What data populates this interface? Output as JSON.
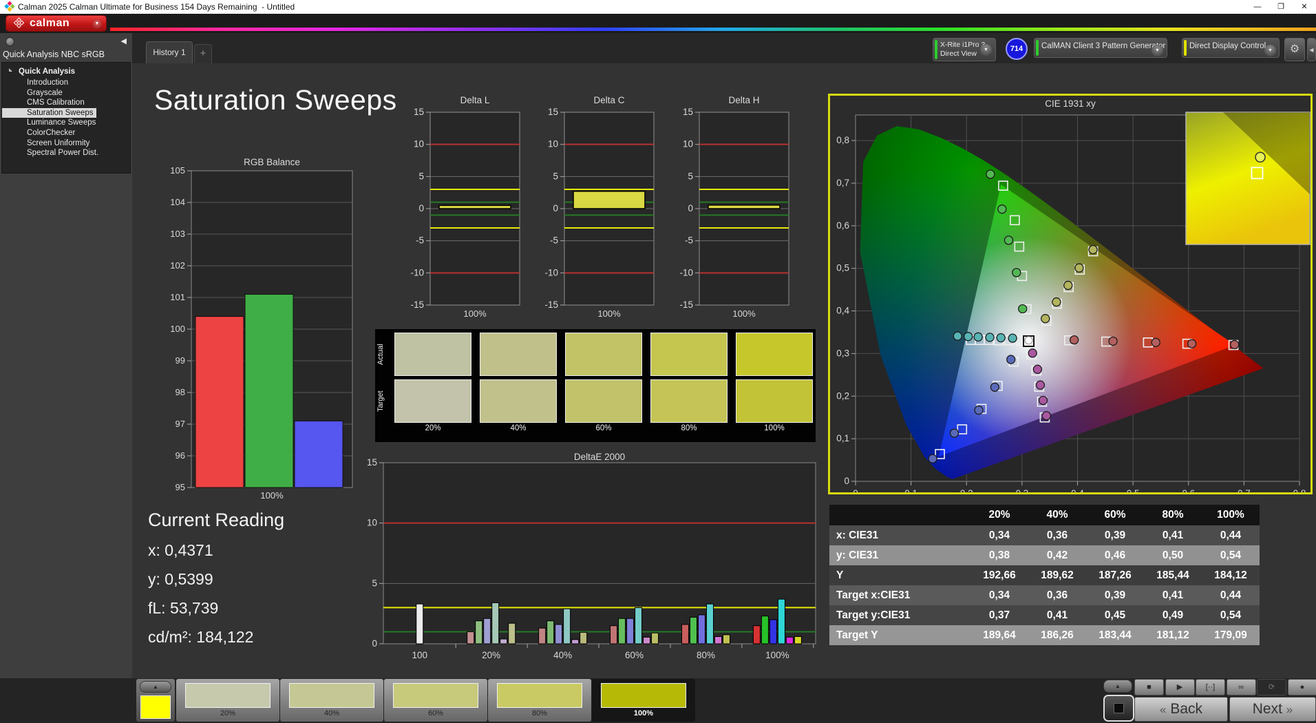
{
  "window": {
    "title": "Calman 2025 Calman Ultimate for Business 154 Days Remaining  - Untitled",
    "minimize": "—",
    "restore": "❐",
    "close": "✕"
  },
  "brand": {
    "logo_text": "calman"
  },
  "tabs": {
    "active": "History 1",
    "add": "+"
  },
  "devices": {
    "meter_line1": "X-Rite i1Pro 3",
    "meter_line2": "Direct View",
    "meter_badge": "714",
    "meter_stripe_color": "#2ecc2e",
    "pattern_generator": "CalMAN Client 3 Pattern Generator",
    "pattern_stripe_color": "#2ecc2e",
    "display_control": "Direct Display Control",
    "display_stripe_color": "#e0e000",
    "gear": "⚙",
    "collapse_arrow": "◀"
  },
  "sidebar": {
    "title": "Quick Analysis NBC sRGB",
    "root": "Quick Analysis",
    "items": [
      {
        "label": "Introduction",
        "selected": false
      },
      {
        "label": "Grayscale",
        "selected": false
      },
      {
        "label": "CMS Calibration",
        "selected": false
      },
      {
        "label": "Saturation Sweeps",
        "selected": true
      },
      {
        "label": "Luminance Sweeps",
        "selected": false
      },
      {
        "label": "ColorChecker",
        "selected": false
      },
      {
        "label": "Screen Uniformity",
        "selected": false
      },
      {
        "label": "Spectral Power Dist.",
        "selected": false
      }
    ]
  },
  "page": {
    "title": "Saturation Sweeps"
  },
  "current_reading": {
    "title": "Current Reading",
    "x": "x: 0,4371",
    "y": "y: 0,5399",
    "fl": "fL: 53,739",
    "cdm2": "cd/m²: 184,122"
  },
  "swatch_panel": {
    "row_labels": [
      "Actual",
      "Target"
    ],
    "labels": [
      "20%",
      "40%",
      "60%",
      "80%",
      "100%"
    ],
    "actual": [
      "#bfc2a3",
      "#bfc08a",
      "#c2c366",
      "#c5c650",
      "#c6c72a"
    ],
    "target": [
      "#c2c3aa",
      "#c0c18b",
      "#c1c269",
      "#c4c556",
      "#c2c336"
    ]
  },
  "table": {
    "headers": [
      "",
      "20%",
      "40%",
      "60%",
      "80%",
      "100%"
    ],
    "rows": [
      {
        "label": "x: CIE31",
        "values": [
          "0,34",
          "0,36",
          "0,39",
          "0,41",
          "0,44"
        ],
        "bg": "#4c4c4c"
      },
      {
        "label": "y: CIE31",
        "values": [
          "0,38",
          "0,42",
          "0,46",
          "0,50",
          "0,54"
        ],
        "bg": "#919191"
      },
      {
        "label": "Y",
        "values": [
          "192,66",
          "189,62",
          "187,26",
          "185,44",
          "184,12"
        ],
        "bg": "#3c3c3c"
      },
      {
        "label": "Target x:CIE31",
        "values": [
          "0,34",
          "0,36",
          "0,39",
          "0,41",
          "0,44"
        ],
        "bg": "#5a5a5a"
      },
      {
        "label": "Target y:CIE31",
        "values": [
          "0,37",
          "0,41",
          "0,45",
          "0,49",
          "0,54"
        ],
        "bg": "#454545"
      },
      {
        "label": "Target Y",
        "values": [
          "189,64",
          "186,26",
          "183,44",
          "181,12",
          "179,09"
        ],
        "bg": "#969696"
      }
    ]
  },
  "bottom_bar": {
    "mini_swatch_color": "#ffff00",
    "swatches": [
      {
        "label": "20%",
        "color": "#c6c9ac",
        "selected": false
      },
      {
        "label": "40%",
        "color": "#c5c794",
        "selected": false
      },
      {
        "label": "60%",
        "color": "#c7c97b",
        "selected": false
      },
      {
        "label": "80%",
        "color": "#caca64",
        "selected": false
      },
      {
        "label": "100%",
        "color": "#b6ba06",
        "selected": true
      }
    ],
    "icons": [
      "■",
      "▶",
      "[··]",
      "∞",
      "⟳",
      "●"
    ],
    "back": "Back",
    "next": "Next",
    "back_chev": "«",
    "next_chev": "»",
    "up_arrow": "▲"
  },
  "chart_data": [
    {
      "id": "rgb_balance",
      "type": "bar",
      "title": "RGB Balance",
      "categories": [
        "Red",
        "Green",
        "Blue"
      ],
      "values": [
        100.4,
        101.1,
        97.1
      ],
      "colors": [
        "#ee4343",
        "#3fae46",
        "#5656f0"
      ],
      "xlabel": "100%",
      "ylim": [
        95,
        105
      ],
      "ytick_step": 1,
      "grid": true
    },
    {
      "id": "delta_l",
      "type": "delta-bar",
      "title": "Delta L",
      "value": 0.5,
      "bar_color": "#d9d943",
      "xlabel": "100%",
      "ylim": [
        -15,
        15
      ],
      "yticks": [
        15,
        10,
        5,
        0,
        -5,
        -10,
        -15
      ],
      "ref_lines": [
        {
          "y": 10,
          "color": "#b93030"
        },
        {
          "y": -10,
          "color": "#b93030"
        },
        {
          "y": 3,
          "color": "#e8e80a"
        },
        {
          "y": -3,
          "color": "#e8e80a"
        },
        {
          "y": 1,
          "color": "#267a26"
        },
        {
          "y": -1,
          "color": "#267a26"
        }
      ]
    },
    {
      "id": "delta_c",
      "type": "delta-bar",
      "title": "Delta C",
      "value": 2.7,
      "bar_color": "#d9d943",
      "xlabel": "100%",
      "ylim": [
        -15,
        15
      ],
      "yticks": [
        15,
        10,
        5,
        0,
        -5,
        -10,
        -15
      ],
      "ref_lines": [
        {
          "y": 10,
          "color": "#b93030"
        },
        {
          "y": -10,
          "color": "#b93030"
        },
        {
          "y": 3,
          "color": "#e8e80a"
        },
        {
          "y": -3,
          "color": "#e8e80a"
        },
        {
          "y": 1,
          "color": "#267a26"
        },
        {
          "y": -1,
          "color": "#267a26"
        }
      ]
    },
    {
      "id": "delta_h",
      "type": "delta-bar",
      "title": "Delta H",
      "value": 0.55,
      "bar_color": "#d9d943",
      "xlabel": "100%",
      "ylim": [
        -15,
        15
      ],
      "yticks": [
        15,
        10,
        5,
        0,
        -5,
        -10,
        -15
      ],
      "ref_lines": [
        {
          "y": 10,
          "color": "#b93030"
        },
        {
          "y": -10,
          "color": "#b93030"
        },
        {
          "y": 3,
          "color": "#e8e80a"
        },
        {
          "y": -3,
          "color": "#e8e80a"
        },
        {
          "y": 1,
          "color": "#267a26"
        },
        {
          "y": -1,
          "color": "#267a26"
        }
      ]
    },
    {
      "id": "deltae_2000",
      "type": "grouped-bar",
      "title": "DeltaE 2000",
      "ylim": [
        0,
        15
      ],
      "yticks": [
        0,
        5,
        10,
        15
      ],
      "ref_lines": [
        {
          "y": 10,
          "color": "#b93030"
        },
        {
          "y": 3,
          "color": "#e8e80a"
        },
        {
          "y": 1,
          "color": "#267a26"
        }
      ],
      "groups": [
        {
          "label": "100",
          "values": [
            3.3
          ],
          "colors": [
            "#ececec"
          ]
        },
        {
          "label": "20%",
          "values": [
            1.0,
            1.9,
            2.1,
            3.4,
            0.4,
            1.7
          ],
          "colors": [
            "#c18f8f",
            "#8fbf80",
            "#9f9fd2",
            "#a6c8b6",
            "#c0aed0",
            "#bcbf8a"
          ]
        },
        {
          "label": "40%",
          "values": [
            1.3,
            1.9,
            1.6,
            2.9,
            0.35,
            0.95
          ],
          "colors": [
            "#c08484",
            "#7eba72",
            "#8f8fd2",
            "#8ec8c2",
            "#c49fd0",
            "#b8ba7c"
          ]
        },
        {
          "label": "60%",
          "values": [
            1.5,
            2.1,
            2.1,
            3.0,
            0.55,
            0.9
          ],
          "colors": [
            "#c27474",
            "#67bc5e",
            "#8080d8",
            "#73ccc8",
            "#cc8bcc",
            "#babd66"
          ]
        },
        {
          "label": "80%",
          "values": [
            1.6,
            2.2,
            2.4,
            3.3,
            0.6,
            0.75
          ],
          "colors": [
            "#c85e5e",
            "#4fc04f",
            "#6f6fde",
            "#5bd0d0",
            "#d476d4",
            "#c0c252"
          ]
        },
        {
          "label": "100%",
          "values": [
            1.5,
            2.3,
            2.0,
            3.7,
            0.55,
            0.6
          ],
          "colors": [
            "#d63232",
            "#28c228",
            "#3333e6",
            "#2fd6d6",
            "#dc2adc",
            "#d6d626"
          ]
        }
      ]
    },
    {
      "id": "cie_1931",
      "type": "scatter",
      "title": "CIE 1931 xy",
      "xlim": [
        0,
        0.8
      ],
      "ylim": [
        0,
        0.86
      ],
      "xticks": [
        "0",
        "0,1",
        "0,2",
        "0,3",
        "0,4",
        "0,5",
        "0,6",
        "0,7",
        "0,8"
      ],
      "yticks": [
        "0",
        "0,1",
        "0,2",
        "0,3",
        "0,4",
        "0,5",
        "0,6",
        "0,7",
        "0,8"
      ],
      "gamut_triangle": [
        [
          0.684,
          0.32
        ],
        [
          0.262,
          0.697
        ],
        [
          0.15,
          0.058
        ]
      ],
      "white_point": {
        "square": [
          0.312,
          0.329
        ],
        "circle": [
          0.312,
          0.331
        ]
      },
      "series": [
        {
          "name": "red-sweep",
          "color": "#b46060",
          "squares": [
            [
              0.385,
              0.331
            ],
            [
              0.452,
              0.328
            ],
            [
              0.527,
              0.326
            ],
            [
              0.598,
              0.323
            ],
            [
              0.681,
              0.32
            ]
          ],
          "circles": [
            [
              0.394,
              0.332
            ],
            [
              0.464,
              0.329
            ],
            [
              0.541,
              0.326
            ],
            [
              0.606,
              0.323
            ],
            [
              0.683,
              0.321
            ]
          ]
        },
        {
          "name": "green-sweep",
          "color": "#52b852",
          "squares": [
            [
              0.308,
              0.404
            ],
            [
              0.3,
              0.482
            ],
            [
              0.295,
              0.551
            ],
            [
              0.287,
              0.613
            ],
            [
              0.266,
              0.694
            ]
          ],
          "circles": [
            [
              0.301,
              0.405
            ],
            [
              0.29,
              0.49
            ],
            [
              0.276,
              0.566
            ],
            [
              0.264,
              0.639
            ],
            [
              0.243,
              0.721
            ]
          ]
        },
        {
          "name": "yellow-sweep",
          "color": "#b2b45e",
          "squares": [
            [
              0.344,
              0.377
            ],
            [
              0.363,
              0.417
            ],
            [
              0.384,
              0.456
            ],
            [
              0.404,
              0.497
            ],
            [
              0.428,
              0.54
            ]
          ],
          "circles": [
            [
              0.342,
              0.382
            ],
            [
              0.362,
              0.421
            ],
            [
              0.383,
              0.46
            ],
            [
              0.403,
              0.501
            ],
            [
              0.428,
              0.544
            ]
          ]
        },
        {
          "name": "cyan-sweep",
          "color": "#58b4b4",
          "squares": [
            [
              0.208,
              0.332
            ],
            [
              0.224,
              0.332
            ],
            [
              0.24,
              0.332
            ],
            [
              0.258,
              0.331
            ],
            [
              0.277,
              0.331
            ],
            [
              0.298,
              0.33
            ]
          ],
          "circles": [
            [
              0.184,
              0.341
            ],
            [
              0.203,
              0.34
            ],
            [
              0.221,
              0.339
            ],
            [
              0.242,
              0.338
            ],
            [
              0.262,
              0.337
            ],
            [
              0.283,
              0.336
            ]
          ]
        },
        {
          "name": "blue-sweep",
          "color": "#5a6ab8",
          "squares": [
            [
              0.285,
              0.281
            ],
            [
              0.256,
              0.224
            ],
            [
              0.227,
              0.17
            ],
            [
              0.192,
              0.122
            ],
            [
              0.152,
              0.064
            ]
          ],
          "circles": [
            [
              0.28,
              0.286
            ],
            [
              0.251,
              0.221
            ],
            [
              0.222,
              0.167
            ],
            [
              0.178,
              0.113
            ],
            [
              0.139,
              0.053
            ]
          ]
        },
        {
          "name": "magenta-sweep",
          "color": "#aa58a0",
          "squares": [
            [
              0.317,
              0.298
            ],
            [
              0.326,
              0.26
            ],
            [
              0.331,
              0.222
            ],
            [
              0.336,
              0.187
            ],
            [
              0.341,
              0.15
            ]
          ],
          "circles": [
            [
              0.319,
              0.301
            ],
            [
              0.328,
              0.263
            ],
            [
              0.333,
              0.226
            ],
            [
              0.338,
              0.19
            ],
            [
              0.344,
              0.154
            ]
          ]
        }
      ],
      "inset": {
        "circle": [
          0.6,
          0.34
        ],
        "square": [
          0.575,
          0.46
        ]
      }
    }
  ]
}
